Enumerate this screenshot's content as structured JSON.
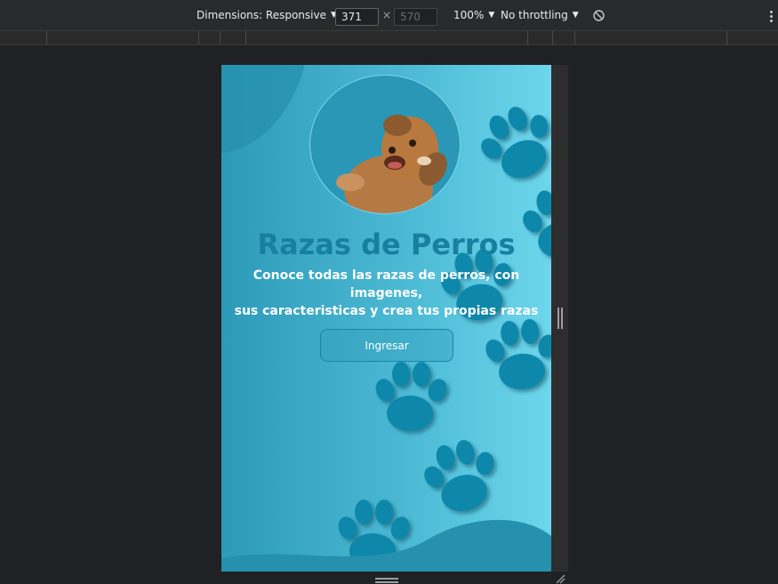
{
  "devtools": {
    "dimensions_label": "Dimensions: Responsive",
    "width_value": "371",
    "height_value": "570",
    "times_symbol": "×",
    "zoom_label": "100%",
    "throttling_label": "No throttling",
    "rotate_icon": "rotate-icon",
    "more_icon": "more-vert-icon"
  },
  "page": {
    "title": "Razas de Perros",
    "subtitle_line1": "Conoce todas las razas de perros, con imagenes,",
    "subtitle_line2": "sus caracteristicas y crea tus propias razas",
    "button_label": "Ingresar",
    "hero_image": "dog-photo",
    "decoration_icon": "paw-print-icon"
  },
  "colors": {
    "devtools_bg": "#202124",
    "toolbar_bg": "#292a2d",
    "page_gradient_start": "#2d9ab8",
    "page_gradient_end": "#6dd6ec",
    "title_color": "#177fa0",
    "paw_color": "#0f88aa"
  }
}
